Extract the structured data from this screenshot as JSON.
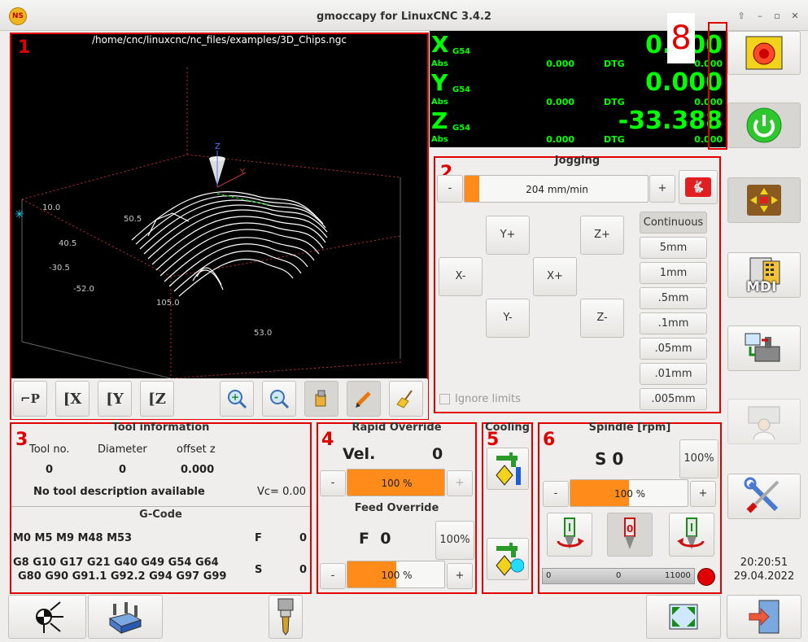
{
  "window": {
    "title": "gmoccapy for LinuxCNC  3.4.2",
    "logo_text": "NS"
  },
  "preview": {
    "file_path": "/home/cnc/linuxcnc/nc_files/examples/3D_Chips.ngc",
    "markers": [
      "1",
      "2",
      "3",
      "4",
      "5",
      "6",
      "8"
    ],
    "toolbar": [
      "view-p",
      "view-x",
      "view-y",
      "view-z",
      "zoom-in",
      "zoom-out",
      "clear-live-plot",
      "edit",
      "clear"
    ],
    "view_labels": {
      "p": "P",
      "x": "X",
      "y": "Y",
      "z": "Z"
    },
    "axis_labels": [
      "10.0",
      "40.5",
      "-30.5",
      "-52.0",
      "105.0",
      "53.0",
      "50.5",
      "Z",
      "Y"
    ]
  },
  "dro": {
    "axes": [
      {
        "letter": "X",
        "offset": "G54",
        "value": "0.000",
        "abs_label": "Abs",
        "abs": "0.000",
        "dtg_label": "DTG",
        "dtg": "0.000"
      },
      {
        "letter": "Y",
        "offset": "G54",
        "value": "0.000",
        "abs_label": "Abs",
        "abs": "0.000",
        "dtg_label": "DTG",
        "dtg": "0.000"
      },
      {
        "letter": "Z",
        "offset": "G54",
        "value": "-33.388",
        "abs_label": "Abs",
        "abs": "0.000",
        "dtg_label": "DTG",
        "dtg": "0.000"
      }
    ]
  },
  "jogging": {
    "title": "Jogging",
    "minus": "-",
    "plus": "+",
    "speed": "204 mm/min",
    "speed_fraction": 0.08,
    "buttons": {
      "y_plus": "Y+",
      "z_plus": "Z+",
      "x_minus": "X-",
      "x_plus": "X+",
      "y_minus": "Y-",
      "z_minus": "Z-"
    },
    "increments": [
      "Continuous",
      "5mm",
      "1mm",
      ".5mm",
      ".1mm",
      ".05mm",
      ".01mm",
      ".005mm"
    ],
    "ignore_limits": "Ignore limits"
  },
  "tool": {
    "title": "Tool information",
    "headers": [
      "Tool no.",
      "Diameter",
      "offset z"
    ],
    "values": [
      "0",
      "0",
      "0.000"
    ],
    "description": "No tool description available",
    "vc": "Vc= 0.00"
  },
  "gcode": {
    "title": "G-Code",
    "mcodes": "M0 M5 M9 M48 M53",
    "f_label": "F",
    "f_value": "0",
    "gcodes_1": "G8 G10 G17 G21 G40 G49 G54 G64",
    "gcodes_2": "G80 G90 G91.1 G92.2 G94 G97 G99",
    "s_label": "S",
    "s_value": "0"
  },
  "rapid": {
    "title": "Rapid Override",
    "vel_label": "Vel.",
    "vel_value": "0",
    "bar": "100 %",
    "fraction": 1.0,
    "minus": "-",
    "plus": "+"
  },
  "feed": {
    "title": "Feed Override",
    "label": "F  0",
    "reset": "100%",
    "bar": "100 %",
    "fraction": 0.5,
    "minus": "-",
    "plus": "+"
  },
  "cooling": {
    "title": "Cooling"
  },
  "spindle": {
    "title": "Spindle [rpm]",
    "speed": "S 0",
    "reset": "100%",
    "bar": "100 %",
    "fraction": 0.5,
    "minus": "-",
    "plus": "+",
    "gauge_min": "0",
    "gauge_val": "0",
    "gauge_max": "11000",
    "indicator_color": "#e00000"
  },
  "clock": {
    "time": "20:20:51",
    "date": "29.04.2022"
  },
  "side": {
    "mdi_label": "MDI"
  },
  "colors": {
    "accent": "#ff8c1a",
    "marker": "#e00000",
    "dro": "#00ff00"
  }
}
